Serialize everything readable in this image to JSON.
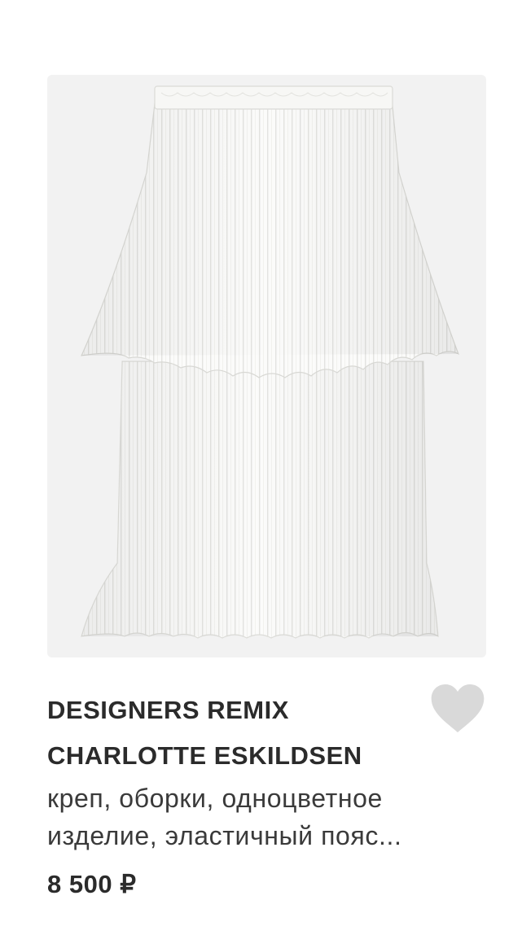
{
  "product": {
    "image_alt": "white pleated skirt",
    "brand_line1": "DESIGNERS REMIX",
    "brand_line2": "CHARLOTTE ESKILDSEN",
    "description_line1": "креп, оборки, одноцветное",
    "description_line2": "изделие, эластичный пояс...",
    "price": "8 500 ₽",
    "favorite_icon": "heart-icon",
    "colors": {
      "image_background": "#f2f2f2",
      "heart": "#d9d9d9",
      "text": "#2b2b2b"
    }
  }
}
